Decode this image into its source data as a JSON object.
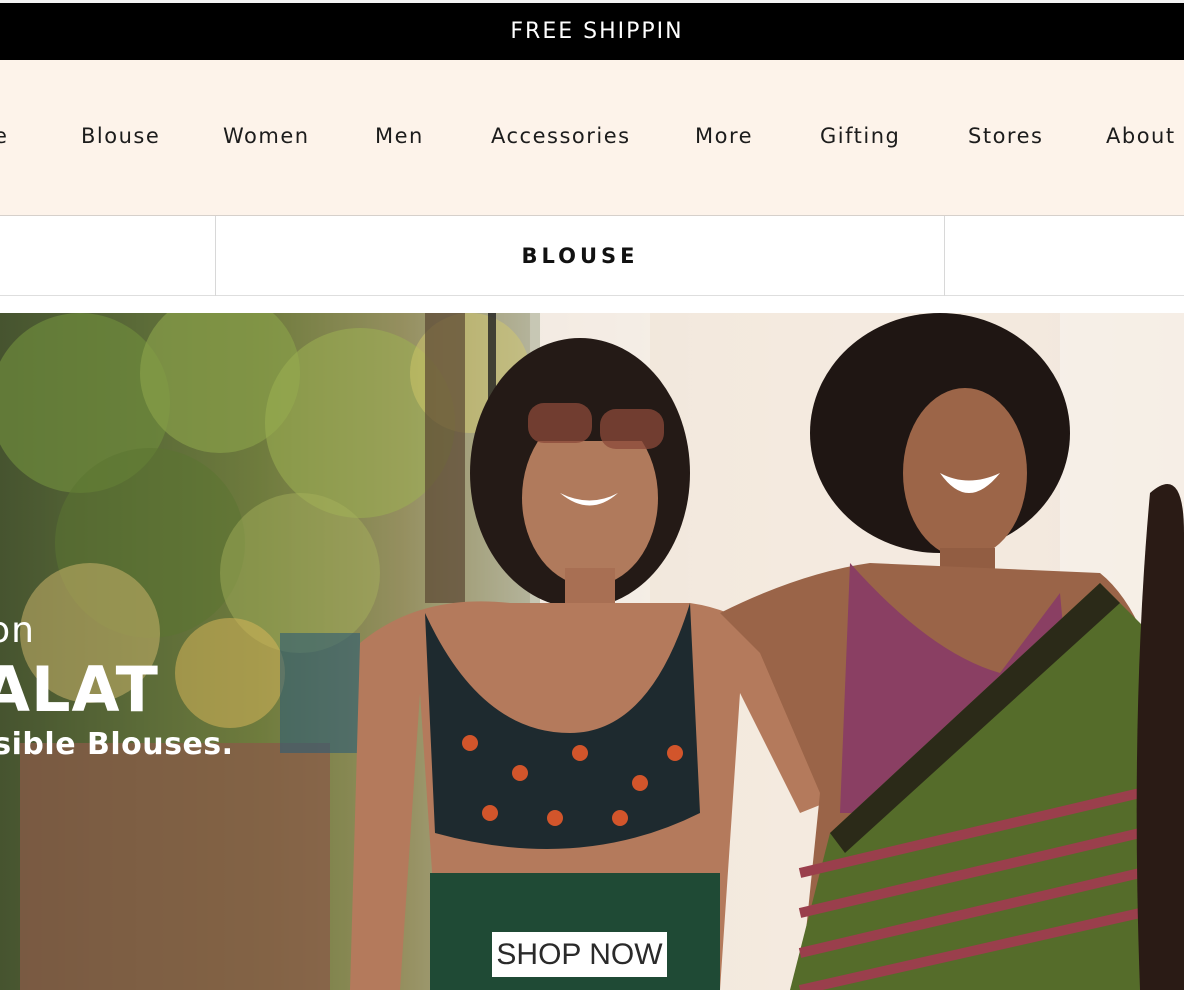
{
  "announcement": {
    "text": "FREE SHIPPIN"
  },
  "nav": {
    "items": [
      {
        "label": "e"
      },
      {
        "label": "Blouse"
      },
      {
        "label": "Women"
      },
      {
        "label": "Men"
      },
      {
        "label": "Accessories"
      },
      {
        "label": "More"
      },
      {
        "label": "Gifting"
      },
      {
        "label": "Stores"
      },
      {
        "label": "About"
      }
    ]
  },
  "category_strip": {
    "active_label": "BLOUSE"
  },
  "hero": {
    "subtitle": "tion",
    "title": "ALAT",
    "description": "rsible Blouses.",
    "cta_label": "SHOP NOW"
  },
  "colors": {
    "announcement_bg": "#000000",
    "nav_bg": "#fdf3ea",
    "cta_bg": "#ffffff"
  }
}
